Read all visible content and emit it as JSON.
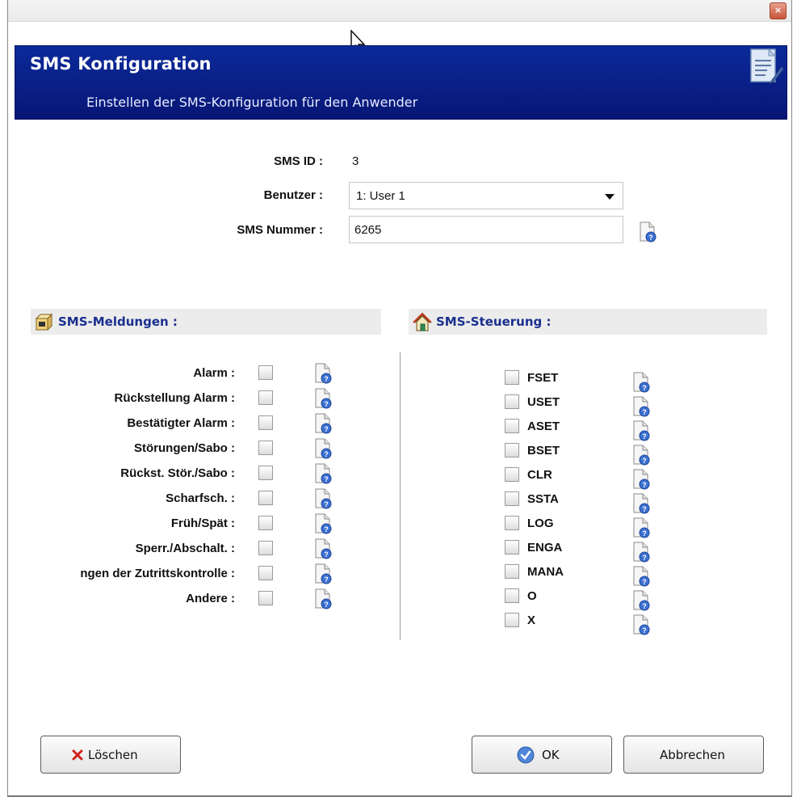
{
  "window": {
    "close_glyph": "×"
  },
  "header": {
    "title": "SMS Konfiguration",
    "subtitle": "Einstellen der SMS-Konfiguration für den Anwender"
  },
  "form": {
    "sms_id_label": "SMS ID :",
    "sms_id_value": "3",
    "user_label": "Benutzer :",
    "user_value": "1: User 1",
    "number_label": "SMS Nummer :",
    "number_value": "6265"
  },
  "messages": {
    "title": "SMS-Meldungen :",
    "items": [
      {
        "label": "Alarm :",
        "checked": false
      },
      {
        "label": "Rückstellung Alarm :",
        "checked": false
      },
      {
        "label": "Bestätigter Alarm :",
        "checked": false
      },
      {
        "label": "Störungen/Sabo :",
        "checked": false
      },
      {
        "label": "Rückst. Stör./Sabo :",
        "checked": false
      },
      {
        "label": "Scharfsch. :",
        "checked": false
      },
      {
        "label": "Früh/Spät :",
        "checked": false
      },
      {
        "label": "Sperr./Abschalt. :",
        "checked": false
      },
      {
        "label": "ngen der Zutrittskontrolle :",
        "checked": false
      },
      {
        "label": "Andere :",
        "checked": false
      }
    ]
  },
  "control": {
    "title": "SMS-Steuerung :",
    "items": [
      {
        "label": "FSET",
        "checked": false
      },
      {
        "label": "USET",
        "checked": false
      },
      {
        "label": "ASET",
        "checked": false
      },
      {
        "label": "BSET",
        "checked": false
      },
      {
        "label": "CLR",
        "checked": false
      },
      {
        "label": "SSTA",
        "checked": false
      },
      {
        "label": "LOG",
        "checked": false
      },
      {
        "label": "ENGA",
        "checked": false
      },
      {
        "label": "MANA",
        "checked": false
      },
      {
        "label": "O",
        "checked": false
      },
      {
        "label": "X",
        "checked": false
      }
    ]
  },
  "buttons": {
    "delete": "Löschen",
    "ok": "OK",
    "cancel": "Abbrechen"
  },
  "colors": {
    "header_blue": "#0a1f86",
    "section_title": "#1a2f8f",
    "section_bg": "#ececec"
  }
}
